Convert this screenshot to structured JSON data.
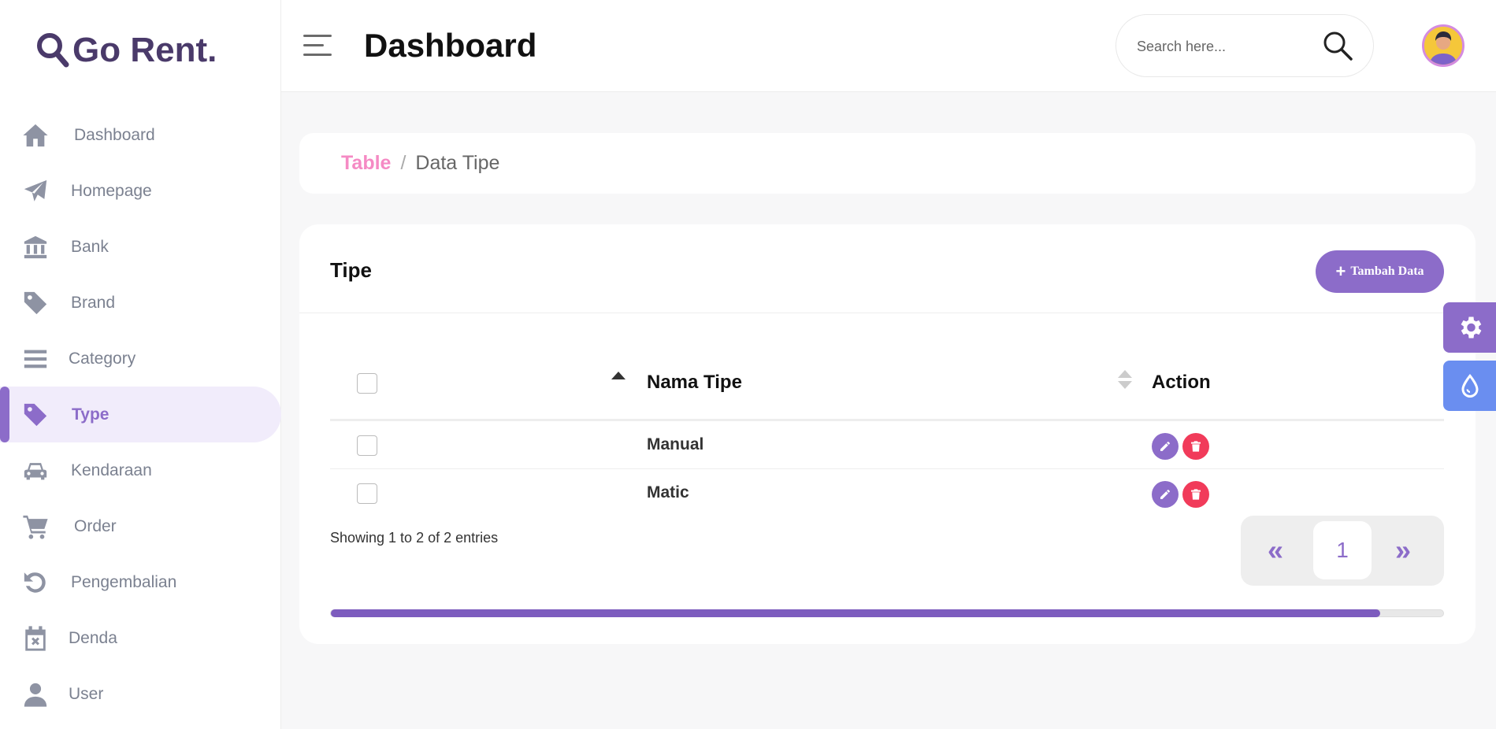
{
  "brand": {
    "name": "Go Rent."
  },
  "sidebar": {
    "items": [
      {
        "label": "Dashboard",
        "icon": "home-icon"
      },
      {
        "label": "Homepage",
        "icon": "paper-plane-icon"
      },
      {
        "label": "Bank",
        "icon": "bank-icon"
      },
      {
        "label": "Brand",
        "icon": "tag-icon"
      },
      {
        "label": "Category",
        "icon": "list-icon"
      },
      {
        "label": "Type",
        "icon": "tag-icon",
        "active": true
      },
      {
        "label": "Kendaraan",
        "icon": "car-icon"
      },
      {
        "label": "Order",
        "icon": "cart-icon"
      },
      {
        "label": "Pengembalian",
        "icon": "undo-icon"
      },
      {
        "label": "Denda",
        "icon": "calendar-x-icon"
      },
      {
        "label": "User",
        "icon": "user-icon"
      }
    ]
  },
  "header": {
    "title": "Dashboard",
    "search_placeholder": "Search here..."
  },
  "breadcrumb": {
    "link": "Table",
    "separator": "/",
    "current": "Data Tipe"
  },
  "card": {
    "title": "Tipe",
    "add_button": "Tambah Data",
    "columns": {
      "name": "Nama Tipe",
      "action": "Action"
    },
    "rows": [
      {
        "name": "Manual"
      },
      {
        "name": "Matic"
      }
    ],
    "showing": "Showing 1 to 2 of 2 entries",
    "pagination": {
      "prev": "«",
      "current": "1",
      "next": "»"
    }
  },
  "colors": {
    "accent": "#8c6cc9",
    "breadcrumb_link": "#f58ac4",
    "delete": "#f13b5a",
    "theme_button": "#6a8ef0"
  }
}
